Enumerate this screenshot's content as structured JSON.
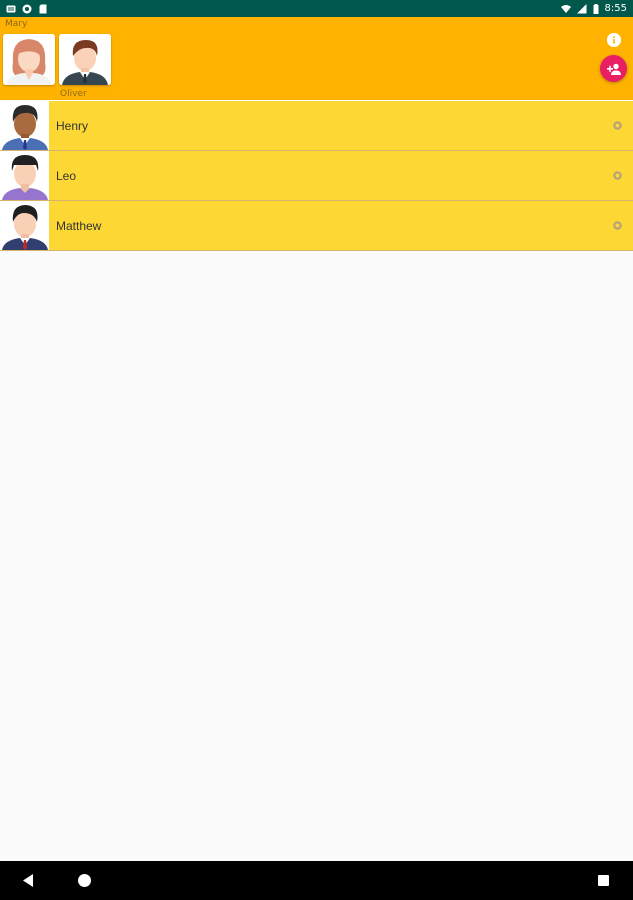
{
  "status_bar": {
    "time": "8:55",
    "left_icons": [
      "notification-icon",
      "circle-app-icon",
      "sd-card-icon"
    ],
    "right_icons": [
      "wifi-icon",
      "signal-icon",
      "battery-icon"
    ]
  },
  "header": {
    "people": [
      {
        "name": "Mary",
        "avatar": "woman-avatar"
      },
      {
        "name": "Oliver",
        "avatar": "man-suit-avatar"
      }
    ],
    "info_icon": "info-icon",
    "add_icon": "add-person-icon",
    "colors": {
      "background": "#ffb300",
      "add_button": "#e91e63"
    }
  },
  "list": {
    "items": [
      {
        "name": "Henry",
        "avatar": "dark-skin-man-avatar"
      },
      {
        "name": "Leo",
        "avatar": "purple-shirt-man-avatar"
      },
      {
        "name": "Matthew",
        "avatar": "tie-man-avatar"
      }
    ],
    "row_color": "#fdd835"
  },
  "nav_bar": {
    "icons": [
      "back-icon",
      "home-icon",
      "recents-icon"
    ]
  }
}
